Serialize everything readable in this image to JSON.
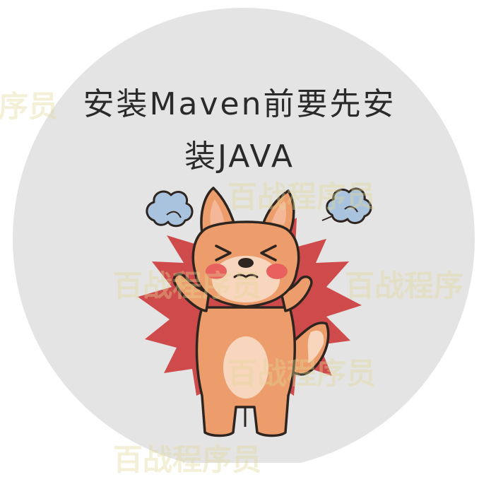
{
  "title": {
    "line1": "安装Maven前要先安",
    "line2": "装JAVA"
  },
  "watermark": {
    "text": "百战程序员",
    "text_short": "百战程序",
    "text_edge": "序员"
  },
  "colors": {
    "circle": "#e4e4e4",
    "burst": "#cf4b4b",
    "dog_fur": "#ec9d6b",
    "dog_belly": "#f8d5bd",
    "blush": "#e8615e",
    "cloud": "#a9c2dd",
    "outline": "#2f2520",
    "title_text": "#2a2a2a",
    "watermark": "#e2d896"
  },
  "illustration": {
    "subject": "frustrated-shiba-dog",
    "elements": [
      "grey-circle-background",
      "red-burst",
      "steam-cloud-left",
      "steam-cloud-right",
      "shiba-dog"
    ]
  }
}
